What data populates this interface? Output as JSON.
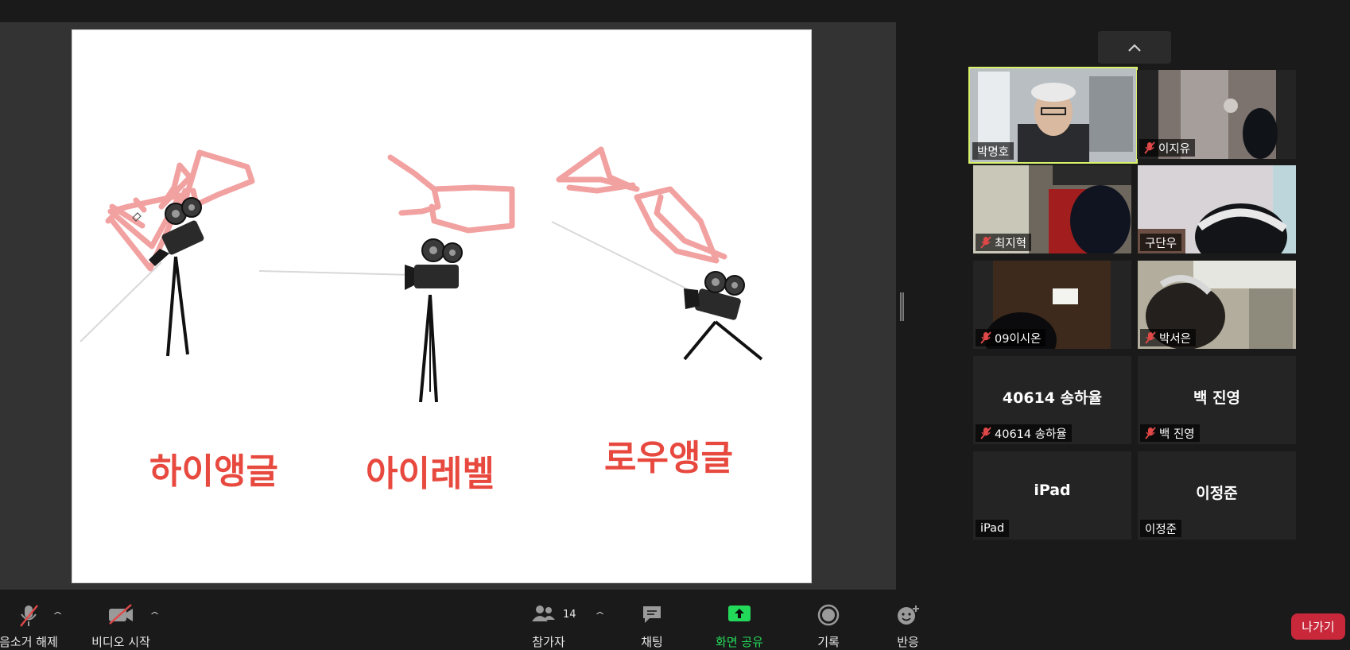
{
  "slide": {
    "labels": [
      "하이앵글",
      "아이레벨",
      "로우앵글"
    ],
    "label_color": "#e8493f",
    "annotation_color": "#f08a8a"
  },
  "gallery": {
    "scroll_up_icon": "chevron-up-icon",
    "active_speaker_color": "#d8f26a",
    "tiles": [
      {
        "name": "박명호",
        "muted": false,
        "video": true
      },
      {
        "name": "이지유",
        "muted": true,
        "video": true
      },
      {
        "name": "최지혁",
        "muted": true,
        "video": true
      },
      {
        "name": "구단우",
        "muted": false,
        "video": true
      },
      {
        "name": "09이시온",
        "muted": true,
        "video": true
      },
      {
        "name": "박서은",
        "muted": true,
        "video": true
      },
      {
        "name": "40614 송하율",
        "display": "40614 송하율",
        "muted": true,
        "video": false
      },
      {
        "name": "백 진영",
        "display": "백 진영",
        "muted": true,
        "video": false
      },
      {
        "name": "iPad",
        "display": "iPad",
        "muted": false,
        "video": false
      },
      {
        "name": "이정준",
        "display": "이정준",
        "muted": false,
        "video": false
      }
    ]
  },
  "toolbar": {
    "unmute": "음소거 해제",
    "video_start": "비디오 시작",
    "participants": "참가자",
    "participant_count": "14",
    "chat": "채팅",
    "share_screen": "화면 공유",
    "record": "기록",
    "reactions": "반응",
    "leave": "나가기",
    "share_color": "#23d959",
    "leave_color": "#c8283a"
  }
}
